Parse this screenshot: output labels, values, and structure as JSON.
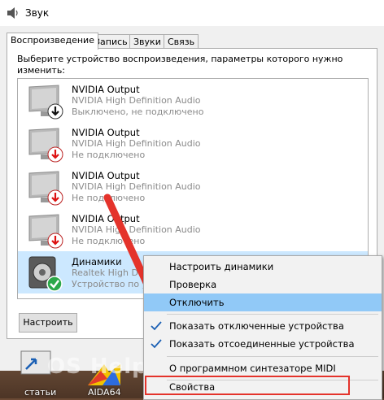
{
  "window": {
    "title": "Звук",
    "app_icon": "speaker-icon"
  },
  "tabs": [
    {
      "label": "Воспроизведение",
      "active": true
    },
    {
      "label": "Запись",
      "active": false
    },
    {
      "label": "Звуки",
      "active": false
    },
    {
      "label": "Связь",
      "active": false
    }
  ],
  "panel": {
    "instruction": "Выберите устройство воспроизведения, параметры которого нужно изменить:",
    "configure_label": "Настроить"
  },
  "devices": [
    {
      "name": "NVIDIA Output",
      "desc": "NVIDIA High Definition Audio",
      "status": "Выключено, не подключено",
      "icon": "monitor-icon",
      "badge": "down-arrow-black-icon",
      "selected": false
    },
    {
      "name": "NVIDIA Output",
      "desc": "NVIDIA High Definition Audio",
      "status": "Не подключено",
      "icon": "monitor-icon",
      "badge": "down-arrow-red-icon",
      "selected": false
    },
    {
      "name": "NVIDIA Output",
      "desc": "NVIDIA High Definition Audio",
      "status": "Не подключено",
      "icon": "monitor-icon",
      "badge": "down-arrow-red-icon",
      "selected": false
    },
    {
      "name": "NVIDIA Output",
      "desc": "NVIDIA High Definition Audio",
      "status": "Не подключено",
      "icon": "monitor-icon",
      "badge": "down-arrow-red-icon",
      "selected": false
    },
    {
      "name": "Динамики",
      "desc": "Realtek High Defi",
      "status": "Устройство по у",
      "icon": "speaker-icon",
      "badge": "green-check-icon",
      "selected": true
    }
  ],
  "context_menu": {
    "items": [
      {
        "label": "Настроить динамики",
        "checked": false,
        "highlighted": false
      },
      {
        "label": "Проверка",
        "checked": false,
        "highlighted": false
      },
      {
        "label": "Отключить",
        "checked": false,
        "highlighted": true
      },
      {
        "label": "Показать отключенные устройства",
        "checked": true,
        "highlighted": false
      },
      {
        "label": "Показать отсоединенные устройства",
        "checked": true,
        "highlighted": false
      },
      {
        "label": "О программном синтезаторе MIDI",
        "checked": false,
        "highlighted": false
      },
      {
        "label": "Свойства",
        "checked": false,
        "highlighted": false
      }
    ]
  },
  "taskbar": {
    "items": [
      {
        "label": "статьи",
        "icon": "shortcut-icon"
      },
      {
        "label": "AIDA64",
        "icon": "aida64-icon"
      }
    ]
  },
  "watermark": "OS Helper",
  "colors": {
    "selection": "#cce8ff",
    "menu_highlight": "#91c9f7",
    "annotation_red": "#e4332b",
    "check_green": "#2ca84a"
  }
}
